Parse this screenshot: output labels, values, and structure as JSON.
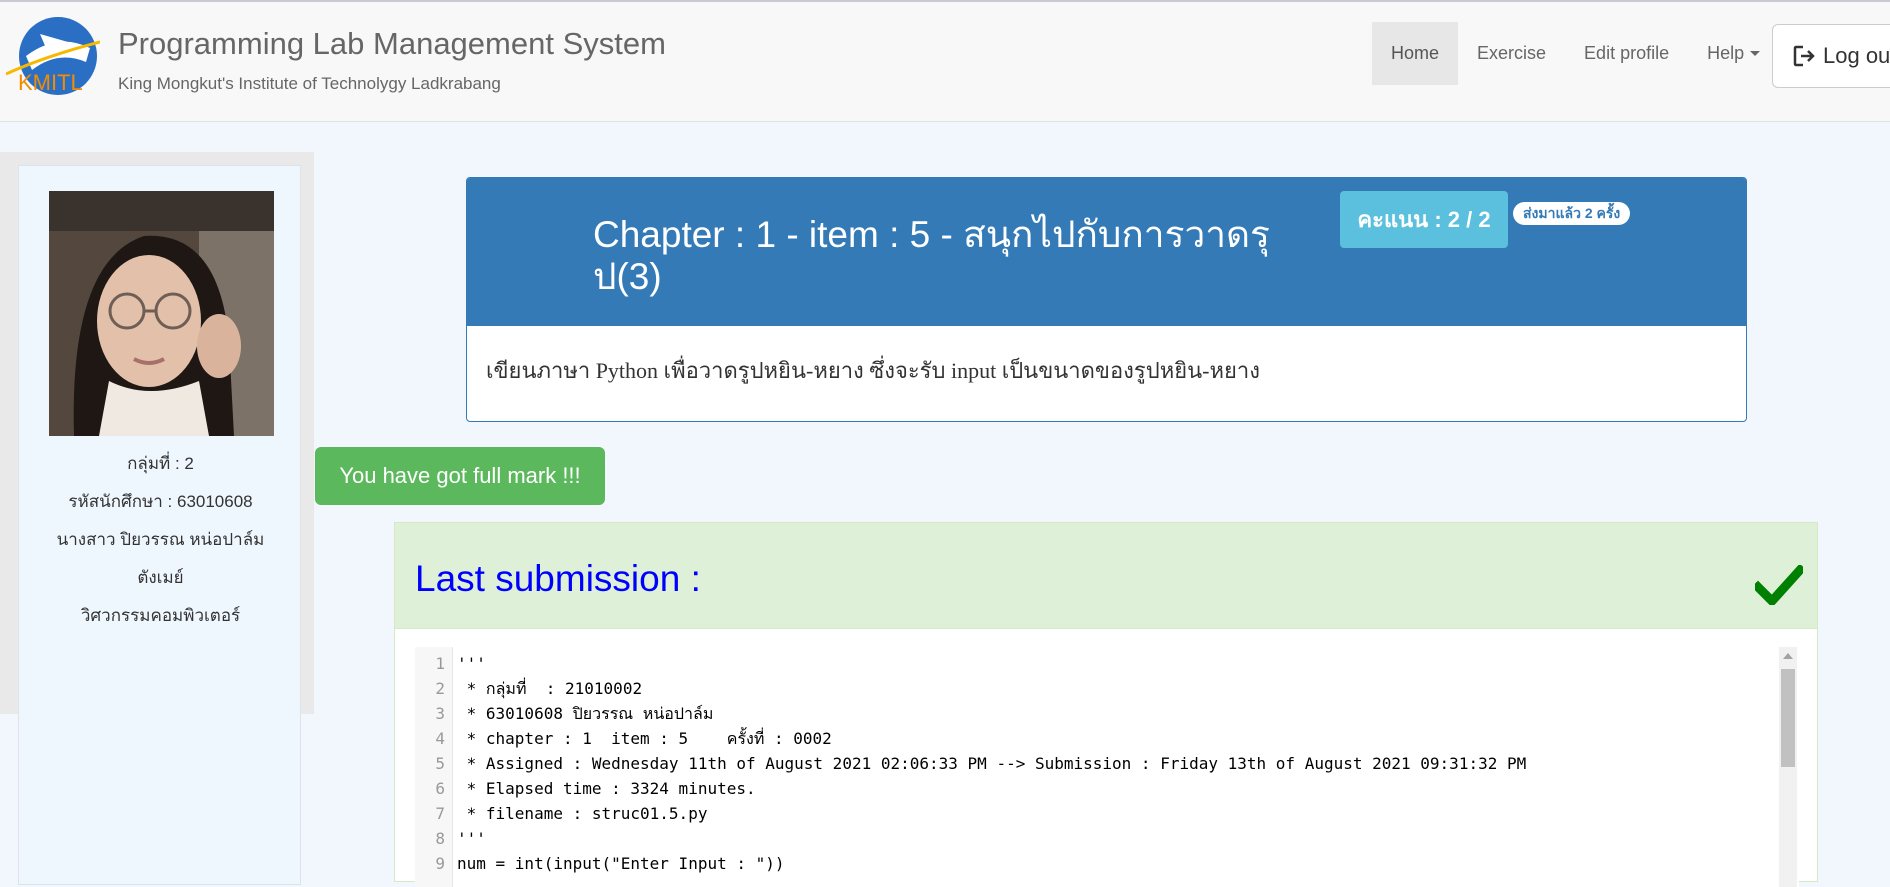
{
  "header": {
    "title": "Programming Lab Management System",
    "subtitle": "King Mongkut's Institute of Technolygy Ladkrabang",
    "logo_text": "KMITL"
  },
  "nav": {
    "items": [
      {
        "label": "Home",
        "active": true
      },
      {
        "label": "Exercise"
      },
      {
        "label": "Edit profile"
      },
      {
        "label": "Help"
      }
    ],
    "logout_label": "Log ou"
  },
  "profile": {
    "group": "กลุ่มที่ : 2",
    "student_id": "รหัสนักศึกษา : 63010608",
    "name": "นางสาว ปิยวรรณ หน่อปาล์ม",
    "nickname": "ตังเมย์",
    "department": "วิศวกรรมคอมพิวเตอร์"
  },
  "problem": {
    "title": "Chapter : 1 - item : 5 - สนุกไปกับการวาดรุป(3)",
    "score": "คะแนน : 2 / 2",
    "submit_count": "ส่งมาแล้ว 2 ครั้ง",
    "description": "เขียนภาษา Python เพื่อวาดรูปหยิน-หยาง ซึ่งจะรับ input เป็นขนาดของรูปหยิน-หยาง"
  },
  "alert": {
    "full_mark": "You have got full mark !!!"
  },
  "submission": {
    "title": "Last submission :",
    "code_lines": [
      {
        "n": "1",
        "text": "'''"
      },
      {
        "n": "2",
        "text": " * กลุ่มที่  : 21010002"
      },
      {
        "n": "3",
        "text": " * 63010608 ปิยวรรณ หน่อปาล์ม"
      },
      {
        "n": "4",
        "text": " * chapter : 1  item : 5    ครั้งที่ : 0002"
      },
      {
        "n": "5",
        "text": " * Assigned : Wednesday 11th of August 2021 02:06:33 PM --> Submission : Friday 13th of August 2021 09:31:32 PM"
      },
      {
        "n": "6",
        "text": " * Elapsed time : 3324 minutes."
      },
      {
        "n": "7",
        "text": " * filename : struc01.5.py"
      },
      {
        "n": "8",
        "text": "'''"
      },
      {
        "n": "9",
        "text": "num = int(input(\"Enter Input : \"))"
      }
    ]
  },
  "colors": {
    "primary": "#337ab7",
    "info": "#5bc0de",
    "success": "#5cb85c",
    "success_bg": "#dff0d8",
    "check": "#008000",
    "submission_title": "#0000ff"
  }
}
